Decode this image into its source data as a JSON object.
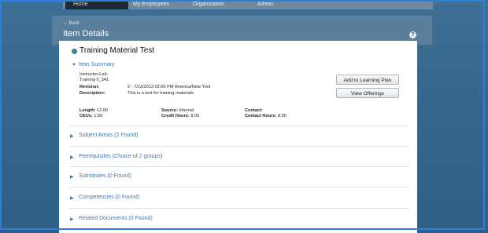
{
  "tabs": [
    {
      "label": "Home"
    },
    {
      "label": "My Employees"
    },
    {
      "label": "Organization"
    },
    {
      "label": "Admin"
    }
  ],
  "header": {
    "back": "← Back",
    "title": "Item Details",
    "help": "?"
  },
  "item": {
    "title": "Training Material Test",
    "summary_label": "Item Summary",
    "type_id": "Instructor-Led-Training 6_341",
    "revision_label": "Revision:",
    "revision_value": "2 - 7/12/2013 02:00 PM America/New York",
    "description_label": "Description:",
    "description_value": "This is a test for training materials.",
    "length_label": "Length:",
    "length_value": "12.00",
    "ceus_label": "CEUs:",
    "ceus_value": "1.00",
    "source_label": "Source:",
    "source_value": "Internal",
    "credit_label": "Credit Hours:",
    "credit_value": "8.00",
    "contact_label": "Contact:",
    "contact_value": "",
    "contact_hours_label": "Contact Hours:",
    "contact_hours_value": "8.00"
  },
  "actions": {
    "add_label": "Add to Learning Plan",
    "view_label": "View Offerings"
  },
  "sections": [
    {
      "label": "Subject Areas (2 Found)"
    },
    {
      "label": "Prerequisites (Choice of 2 groups)"
    },
    {
      "label": "Substitutes (0 Found)"
    },
    {
      "label": "Competencies (0 Found)"
    },
    {
      "label": "Related Documents (0 Found)"
    }
  ]
}
